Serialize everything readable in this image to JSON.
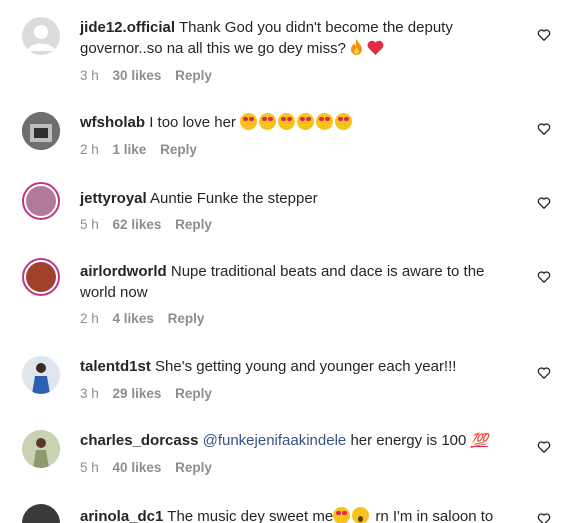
{
  "comments": [
    {
      "username": "jide12.official",
      "text": "Thank God you didn't become the deputy governor..so na all this we go dey miss?",
      "time": "3 h",
      "likes": "30 likes",
      "reply": "Reply",
      "avatar_color": "#dbdbdb"
    },
    {
      "username": "wfsholab",
      "text": "I too love her",
      "time": "2 h",
      "likes": "1 like",
      "reply": "Reply",
      "avatar_color": "#4a4a4a"
    },
    {
      "username": "jettyroyal",
      "text": "Auntie Funke the stepper",
      "time": "5 h",
      "likes": "62 likes",
      "reply": "Reply",
      "avatar_color": "#b07a9a"
    },
    {
      "username": "airlordworld",
      "text": "Nupe traditional beats and dace is aware to the world now",
      "time": "2 h",
      "likes": "4 likes",
      "reply": "Reply",
      "avatar_color": "#a0412d"
    },
    {
      "username": "talentd1st",
      "text": "She's getting young and younger each year!!!",
      "time": "3 h",
      "likes": "29 likes",
      "reply": "Reply",
      "avatar_color": "#2b5fb0"
    },
    {
      "username": "charles_dorcass",
      "mention": "@funkejenifaakindele",
      "text": "her energy is 100",
      "time": "5 h",
      "likes": "40 likes",
      "reply": "Reply",
      "avatar_color": "#8a9a6a"
    },
    {
      "username": "arinola_dc1",
      "text": "The music dey sweet me",
      "text_tail": "rn I'm in saloon to",
      "avatar_color": "#3a3a3a"
    }
  ],
  "icons": {
    "like": "heart-outline-icon",
    "fire": "fire-emoji",
    "red_heart": "red-heart-emoji",
    "heart_eyes": "heart-eyes-emoji",
    "hundred": "hundred-points-emoji",
    "open_mouth": "open-mouth-emoji"
  }
}
